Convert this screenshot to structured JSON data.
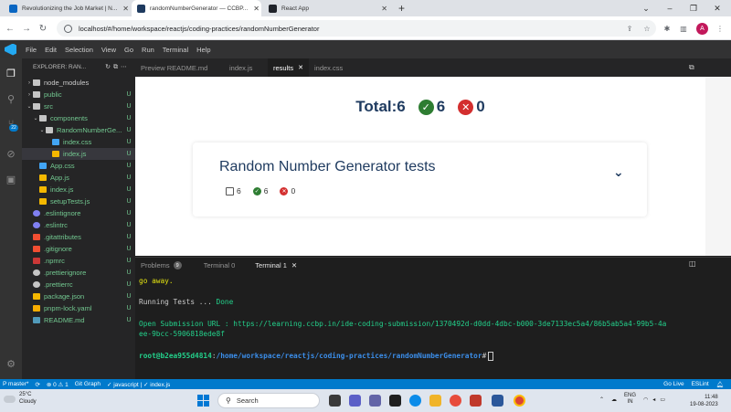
{
  "browser": {
    "tabs": [
      {
        "title": "Revolutionizing the Job Market | N...",
        "active": false
      },
      {
        "title": "randomNumberGenerator — CCBP...",
        "active": true
      },
      {
        "title": "React App",
        "active": false
      }
    ],
    "new_tab": "+",
    "url": "localhost/#/home/workspace/reactjs/coding-practices/randomNumberGenerator",
    "profile_initial": "A"
  },
  "vscode": {
    "menu": [
      "File",
      "Edit",
      "Selection",
      "View",
      "Go",
      "Run",
      "Terminal",
      "Help"
    ],
    "explorer_title": "EXPLORER: RAN...",
    "scm_badge": "22",
    "tree": [
      {
        "name": "node_modules",
        "depth": 0,
        "kind": "folder",
        "chev": "›",
        "status": ""
      },
      {
        "name": "public",
        "depth": 0,
        "kind": "folder",
        "chev": "›",
        "status": "U"
      },
      {
        "name": "src",
        "depth": 0,
        "kind": "folder",
        "chev": "⌄",
        "status": "U"
      },
      {
        "name": "components",
        "depth": 1,
        "kind": "folder",
        "chev": "⌄",
        "status": "U"
      },
      {
        "name": "RandomNumberGe...",
        "depth": 2,
        "kind": "folder",
        "chev": "⌄",
        "status": "U"
      },
      {
        "name": "index.css",
        "depth": 3,
        "kind": "css",
        "chev": "",
        "status": "U"
      },
      {
        "name": "index.js",
        "depth": 3,
        "kind": "js",
        "chev": "",
        "status": "U",
        "selected": true
      },
      {
        "name": "App.css",
        "depth": 1,
        "kind": "css",
        "chev": "",
        "status": "U"
      },
      {
        "name": "App.js",
        "depth": 1,
        "kind": "js",
        "chev": "",
        "status": "U"
      },
      {
        "name": "index.js",
        "depth": 1,
        "kind": "js",
        "chev": "",
        "status": "U"
      },
      {
        "name": "setupTests.js",
        "depth": 1,
        "kind": "js",
        "chev": "",
        "status": "U"
      },
      {
        "name": ".eslintignore",
        "depth": 0,
        "kind": "eslint",
        "chev": "",
        "status": "U"
      },
      {
        "name": ".eslintrc",
        "depth": 0,
        "kind": "eslint",
        "chev": "",
        "status": "U"
      },
      {
        "name": ".gitattributes",
        "depth": 0,
        "kind": "git",
        "chev": "",
        "status": "U"
      },
      {
        "name": ".gitignore",
        "depth": 0,
        "kind": "git",
        "chev": "",
        "status": "U"
      },
      {
        "name": ".npmrc",
        "depth": 0,
        "kind": "npm",
        "chev": "",
        "status": "U"
      },
      {
        "name": ".prettierignore",
        "depth": 0,
        "kind": "cfg",
        "chev": "",
        "status": "U"
      },
      {
        "name": ".prettierrc",
        "depth": 0,
        "kind": "cfg",
        "chev": "",
        "status": "U"
      },
      {
        "name": "package.json",
        "depth": 0,
        "kind": "json",
        "chev": "",
        "status": "U"
      },
      {
        "name": "pnpm-lock.yaml",
        "depth": 0,
        "kind": "pnpm",
        "chev": "",
        "status": "U"
      },
      {
        "name": "README.md",
        "depth": 0,
        "kind": "md",
        "chev": "",
        "status": "U"
      }
    ],
    "editor_tabs": [
      {
        "label": "Preview README.md",
        "active": false
      },
      {
        "label": "index.js",
        "active": false
      },
      {
        "label": "results",
        "active": true
      },
      {
        "label": "index.css",
        "active": false
      }
    ],
    "results": {
      "total_label": "Total:",
      "total": "6",
      "passed": "6",
      "failed": "0",
      "suite_title": "Random Number Generator tests",
      "suite_total": "6",
      "suite_passed": "6",
      "suite_failed": "0"
    },
    "panel_tabs": [
      {
        "label": "Problems",
        "count": "9",
        "active": false
      },
      {
        "label": "Terminal 0",
        "active": false
      },
      {
        "label": "Terminal 1",
        "active": true
      }
    ],
    "terminal": {
      "line1": "go away.",
      "line2_prefix": "Running Tests ... ",
      "line2_done": "Done",
      "line3": "Open Submission URL : https://learning.ccbp.in/ide-coding-submission/1370492d-d0dd-4dbc-b000-3de7133ec5a4/86b5ab5a4-99b5-4a",
      "line4": "ee-9bcc-5906818ede8f",
      "prompt_user": "root@b2ea955d4814",
      "prompt_sep": ":",
      "prompt_path": "/home/workspace/reactjs/coding-practices/randomNumberGenerator",
      "prompt_end": "#"
    },
    "status": {
      "branch": "P master*",
      "sync": "⟳",
      "errors": "⊗ 0 ⚠ 1",
      "git_graph": "Git Graph",
      "lang": "✓ javascript | ✓ index.js",
      "go_live": "Go Live",
      "eslint": "ESLint"
    }
  },
  "taskbar": {
    "temp": "25°C",
    "weather": "Cloudy",
    "search": "Search",
    "lang1": "ENG",
    "lang2": "IN",
    "time": "11:48",
    "date": "19-08-2023"
  },
  "colors": {
    "accent": "#007acc",
    "pass": "#2e7d32",
    "fail": "#d32f2f",
    "heading": "#1e3a5f"
  }
}
